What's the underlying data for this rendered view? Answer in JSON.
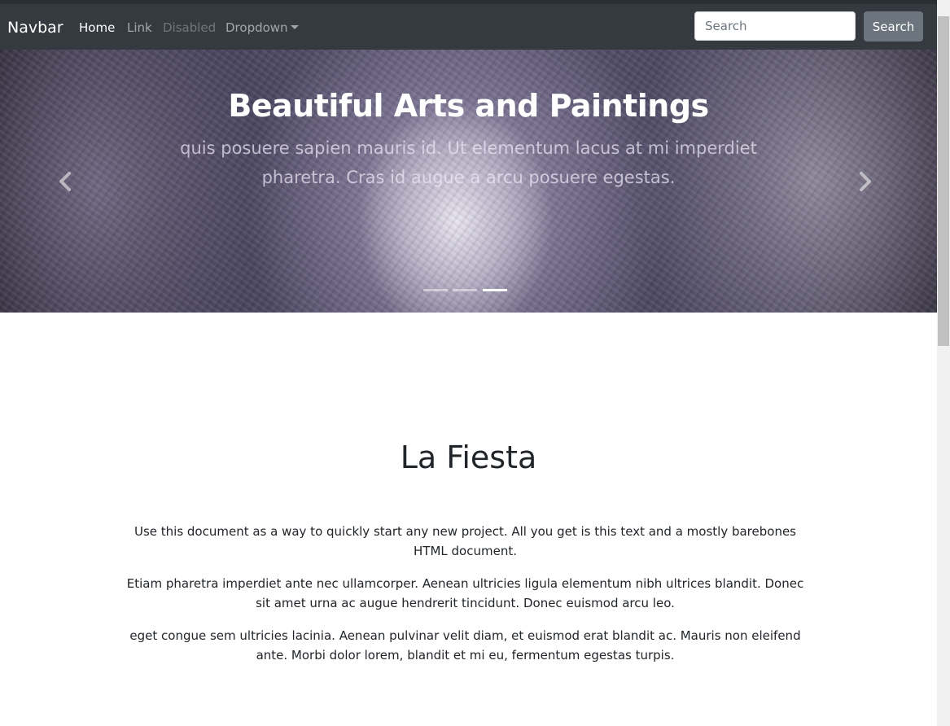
{
  "navbar": {
    "brand": "Navbar",
    "links": [
      "Home",
      "Link",
      "Disabled",
      "Dropdown"
    ],
    "search_placeholder": "Search",
    "search_button": "Search"
  },
  "carousel": {
    "title": "Beautiful Arts and Paintings",
    "text": "quis posuere sapien mauris id. Ut elementum lacus at mi imperdiet pharetra. Cras id augue a arcu posuere egestas.",
    "active_slide_index": 2,
    "slide_count": 3
  },
  "content": {
    "title": "La Fiesta",
    "paragraphs": [
      "Use this document as a way to quickly start any new project. All you get is this text and a mostly barebones HTML document.",
      "Etiam pharetra imperdiet ante nec ullamcorper. Aenean ultricies ligula elementum nibh ultrices blandit. Donec sit amet urna ac augue hendrerit tincidunt. Donec euismod arcu leo.",
      "eget congue sem ultricies lacinia. Aenean pulvinar velit diam, et euismod erat blandit ac. Mauris non eleifend ante. Morbi dolor lorem, blandit et mi eu, fermentum egestas turpis."
    ]
  },
  "icons": {
    "prev": "chevron-left-icon",
    "next": "chevron-right-icon",
    "dropdown": "caret-down-icon"
  },
  "colors": {
    "navbar_bg": "#343a40",
    "button_bg": "#6c757d",
    "text": "#212529"
  }
}
